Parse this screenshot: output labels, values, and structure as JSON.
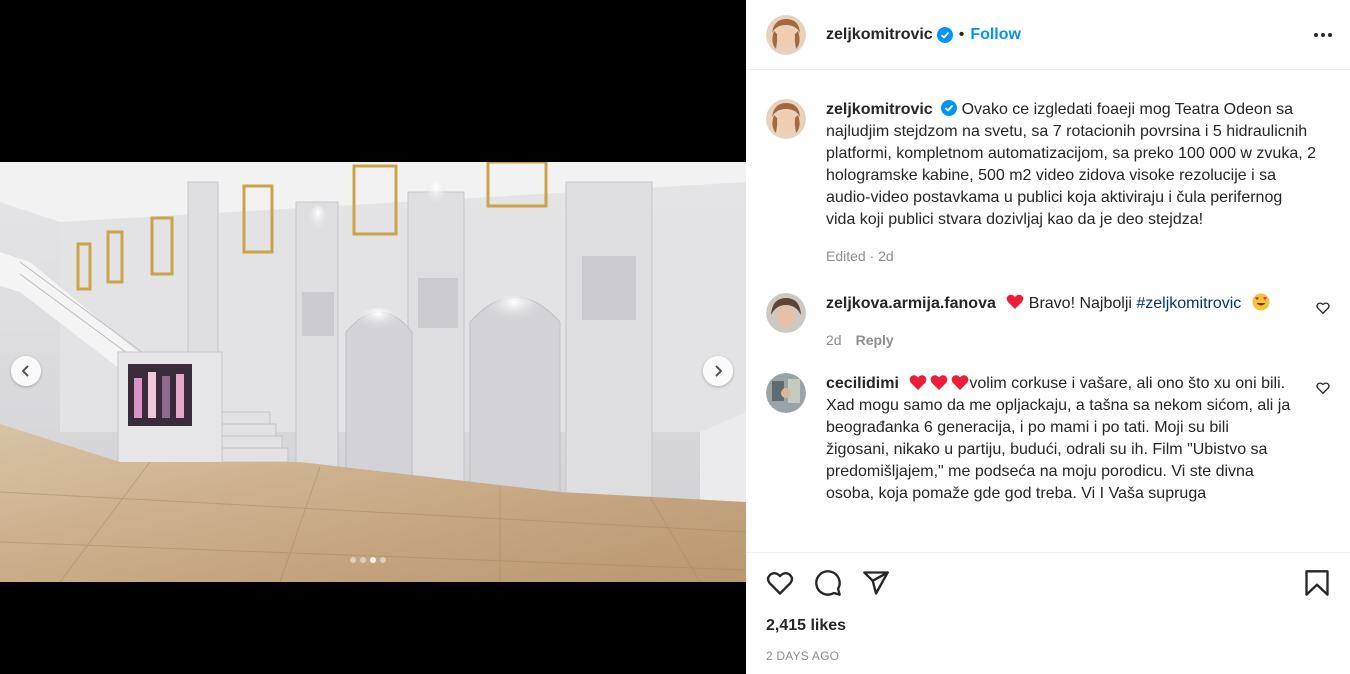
{
  "post": {
    "author": "zeljkomitrovic",
    "follow_label": "Follow",
    "separator": "•",
    "caption": "Ovako ce izgledati foaeji mog Teatra Odeon sa najludjim stejdzom na svetu, sa 7 rotacionih povrsina i 5 hidraulicnih platformi, kompletnom automatizacijom, sa preko 100 000 w zvuka, 2 hologramske kabine, 500 m2 video zidova visoke rezolucije i sa audio-video postavkama u publici koja aktiviraju i čula perifernog vida koji publici stvara dozivljaj kao da je deo stejdza!",
    "caption_meta": "Edited · 2d",
    "likes": "2,415 likes",
    "time_ago": "2 DAYS AGO"
  },
  "carousel": {
    "slide_count": 4,
    "active_slide": 3
  },
  "comments": [
    {
      "user": "zeljkova.armija.fanova",
      "text_before": " Bravo! Najbolji ",
      "hashtag": "#zeljkomitrovic",
      "time": "2d",
      "reply_label": "Reply"
    },
    {
      "user": "cecilidimi",
      "text": "volim corkuse i vašare, ali ono što xu oni bili. Xad mogu samo da me opljackaju, a tašna sa nekom sićom, ali ja beograđanka 6 generacija, i po mami i po tati. Moji su bili žigosani, nikako u partiju, budući, odrali su ih. Film \"Ubistvo sa predomišljajem,\" me podseća na moju porodicu. Vi ste divna osoba, koja pomaže gde god treba. Vi I Vaša supruga"
    }
  ],
  "colors": {
    "accent": "#0095f6",
    "verified": "#0095f6",
    "heart_emoji": "#ed1c3a",
    "text": "#262626",
    "muted": "#8e8e8e"
  },
  "icons": [
    "chevron-left-icon",
    "chevron-right-icon",
    "more-icon",
    "verified-icon",
    "heart-icon",
    "comment-icon",
    "share-icon",
    "bookmark-icon"
  ]
}
